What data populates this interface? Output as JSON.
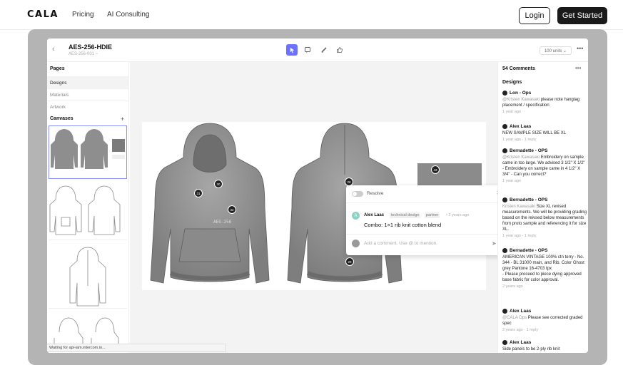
{
  "site": {
    "logo": "CALA",
    "nav": [
      "Pricing",
      "AI Consulting"
    ],
    "login": "Login",
    "get_started": "Get Started"
  },
  "doc": {
    "title": "AES-256-HDIE",
    "subtitle": "AES-256-001 ~",
    "units": "100 units ⌄"
  },
  "left": {
    "pages_heading": "Pages",
    "pages": [
      "Designs",
      "Materials",
      "Artwork"
    ],
    "canvases_heading": "Canvases"
  },
  "status_bar": "Waiting for api-iam.intercom.io...",
  "pins": [
    "31",
    "30",
    "32",
    "28",
    "29",
    "43"
  ],
  "popup": {
    "resolve": "Resolve",
    "author": "Alex Laas",
    "tags": [
      "technical design",
      "partner"
    ],
    "time": "• 2 years ago",
    "body": "Combo: 1×1 rib knit cotton blend",
    "input_placeholder": "Add a comment. Use @ to mention."
  },
  "comments_panel": {
    "title": "54 Comments",
    "section": "Designs",
    "comments": [
      {
        "author": "Lon - Ops",
        "mention": "@Kristen Kawasaki",
        "text": " please note hangtag placement / specification",
        "meta": "1 year ago"
      },
      {
        "author": "Alex Laas",
        "mention": "",
        "text": "NEW SAMPLE SIZE WILL BE XL",
        "meta": "1 year ago · 1 reply"
      },
      {
        "author": "Bernadette - OPS",
        "mention": "@Kristen Kawasaki",
        "text": " Embroidery on sample came in too large. We advised 3 1/2\" X 1/2\" - Embroidery on sample came in 4 1/2\" X 3/4\" - Can you correct?",
        "meta": "1 year ago"
      },
      {
        "author": "Bernadette - OPS",
        "mention": "Kristen Kawasaki",
        "text": " Size XL revised measurements. We will be providing grading based on the reivsed below measurements from proto sample and referencing it for size XL.",
        "meta": "1 year ago · 1 reply"
      },
      {
        "author": "Bernadette - OPS",
        "mention": "",
        "text": "AMERICAN VINTAGE 100% ctn terry - No. 344 - BL 31000 main, and Rib. Color Ghost grey  Pantone 16-4703 tpx\n- Please proceed to piece dying approved base fabric for color approval.",
        "meta": "2 years ago"
      },
      {
        "author": "Alex Laas",
        "mention": "@CALA Ops",
        "text": " Please see corrected graded spec",
        "meta": "2 years ago · 1 reply"
      },
      {
        "author": "Alex Laas",
        "mention": "",
        "text": "Side panels to be 2-ply rib knit",
        "meta": ""
      }
    ]
  },
  "colors": {
    "accent": "#6b72ff",
    "garment": "#8e8e8e",
    "dark": "#1a1a1a"
  }
}
